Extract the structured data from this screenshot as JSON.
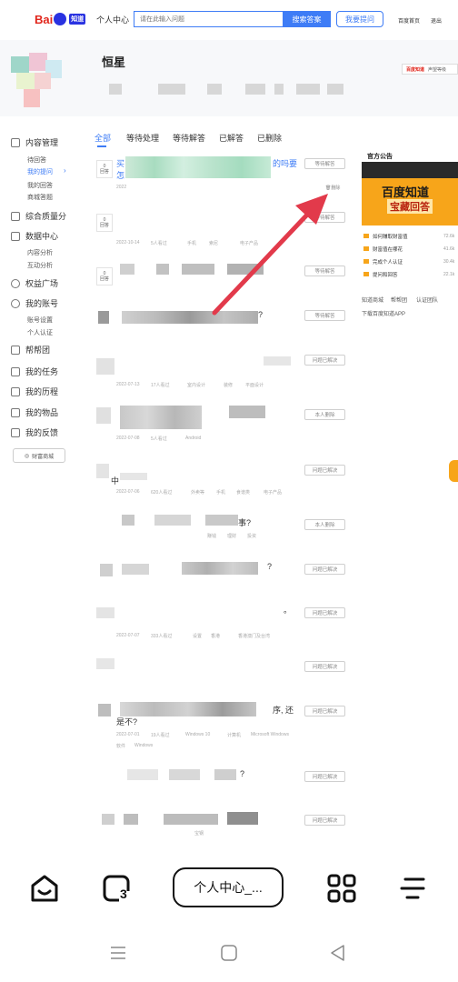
{
  "header": {
    "logo_text": "Bai",
    "logo_sub": "知道",
    "page_tag": "个人中心",
    "search_placeholder": "请在此输入问题",
    "search_button": "搜索答案",
    "ask_button": "我要提问",
    "links": [
      "百度首页",
      "退出"
    ]
  },
  "profile": {
    "username": "恒星",
    "badge_brand": "百度知道",
    "badge_text": "声望等级"
  },
  "sidebar": {
    "groups": [
      {
        "label": "内容管理",
        "icon": "content-icon",
        "subs": [
          "待回答",
          "我的提问",
          "我的回答",
          "商城答题"
        ],
        "active_sub": "我的提问"
      },
      {
        "label": "综合质量分",
        "icon": "quality-icon"
      },
      {
        "label": "数据中心",
        "icon": "data-icon",
        "subs": [
          "内容分析",
          "互动分析"
        ]
      },
      {
        "label": "权益广场",
        "icon": "rights-icon"
      },
      {
        "label": "我的账号",
        "icon": "account-icon",
        "subs": [
          "账号设置",
          "个人认证"
        ]
      },
      {
        "label": "帮帮团",
        "icon": "team-icon"
      },
      {
        "label": "我的任务",
        "icon": "task-icon"
      },
      {
        "label": "我的历程",
        "icon": "history-icon"
      },
      {
        "label": "我的物品",
        "icon": "items-icon"
      },
      {
        "label": "我的反馈",
        "icon": "feedback-icon"
      }
    ],
    "fortune_button": "财富商城"
  },
  "tabs": [
    "全部",
    "等待处理",
    "等待解答",
    "已解答",
    "已删除"
  ],
  "active_tab": "全部",
  "questions": [
    {
      "answers": "0",
      "answers_label": "回答",
      "title_visible": "买",
      "title_tail": "的吗要",
      "title_line2": "怎",
      "status": "等待解答",
      "meta": [
        "2022"
      ],
      "extra": "删除"
    },
    {
      "answers": "0",
      "answers_label": "回答",
      "status": "等待解答",
      "meta": [
        "2022-10-14",
        "5人看过",
        "手机",
        "索尼",
        "电子产品"
      ]
    },
    {
      "answers": "0",
      "answers_label": "回答",
      "status": "等待解答",
      "meta": []
    },
    {
      "title_tail": "?",
      "status": "等待解答",
      "meta": []
    },
    {
      "status": "问题已解决",
      "meta": [
        "2022-07-13",
        "17人看过",
        "室内设计",
        "装修",
        "平面设计"
      ]
    },
    {
      "status": "本人删除",
      "meta": [
        "2022-07-08",
        "5人看过",
        "Android"
      ]
    },
    {
      "title_tail": "中",
      "status": "问题已解决",
      "meta": [
        "2022-07-06",
        "620人看过",
        "外卖等",
        "手机",
        "食谱类",
        "电子产品"
      ]
    },
    {
      "title_tail": "事?",
      "status": "本人删除",
      "meta": [
        "赚钱",
        "理财",
        "投资"
      ]
    },
    {
      "title_tail": "?",
      "status": "问题已解决",
      "meta": []
    },
    {
      "title_tail": "。",
      "status": "问题已解决",
      "meta": [
        "2022-07-07",
        "333人看过",
        "设置",
        "香港",
        "香港澳门及台湾"
      ]
    },
    {
      "status": "问题已解决",
      "meta": []
    },
    {
      "title_tail": "序, 还",
      "title_line2": "是不?",
      "status": "问题已解决",
      "meta": [
        "2022-07-01",
        "19人看过",
        "Windows 10",
        "计算机",
        "Microsoft Windows",
        "软件",
        "Windows"
      ]
    },
    {
      "title_tail": "?",
      "status": "问题已解决",
      "meta": []
    },
    {
      "status": "问题已解决",
      "meta": [
        "宝钢"
      ]
    }
  ],
  "right_column": {
    "title": "官方公告",
    "banner_line1": "百度知道",
    "banner_line2": "宝藏回答",
    "notices": [
      {
        "text": "如何赚取财富值",
        "count": "72.6k"
      },
      {
        "text": "财富值在哪花",
        "count": "41.6k"
      },
      {
        "text": "完成个人认证",
        "count": "30.4k"
      },
      {
        "text": "提问和回答",
        "count": "22.1k"
      }
    ],
    "links": [
      "知道商城",
      "帮帮团",
      "认证团队"
    ],
    "app_link": "下载百度知道APP"
  },
  "browser": {
    "tab_count": "3",
    "url_label": "个人中心_..."
  },
  "colors": {
    "accent": "#3e7cf6",
    "brand_red": "#e1251b",
    "arrow": "#e23a4b",
    "banner": "#f7a51a"
  }
}
